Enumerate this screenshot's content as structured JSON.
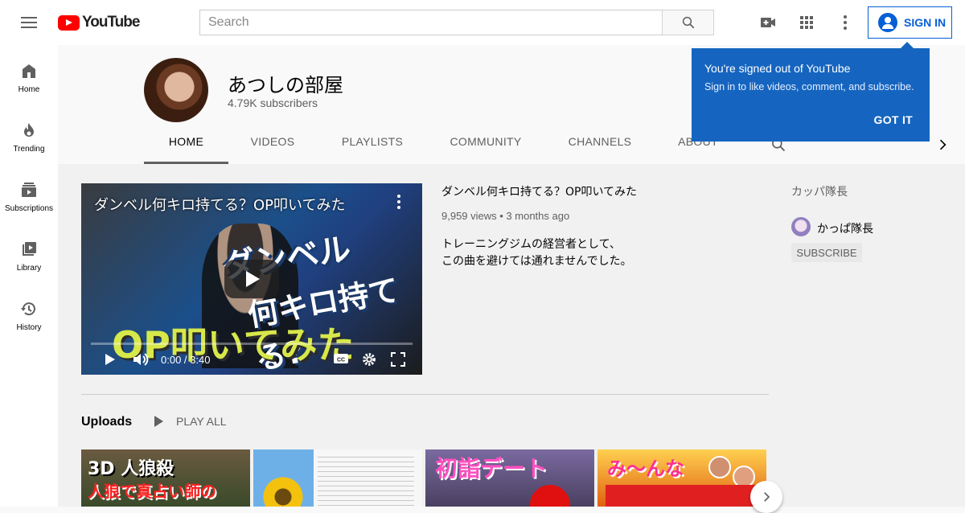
{
  "header": {
    "logo_text": "YouTube",
    "search_placeholder": "Search",
    "signin_label": "SIGN IN",
    "icons": [
      "menu-icon",
      "video-camera-icon",
      "apps-grid-icon",
      "more-vert-icon",
      "search-icon",
      "account-circle-icon"
    ]
  },
  "sidebar": {
    "items": [
      {
        "label": "Home",
        "icon": "home-icon"
      },
      {
        "label": "Trending",
        "icon": "flame-icon"
      },
      {
        "label": "Subscriptions",
        "icon": "subscriptions-icon"
      },
      {
        "label": "Library",
        "icon": "library-icon"
      },
      {
        "label": "History",
        "icon": "history-icon"
      }
    ]
  },
  "channel": {
    "name": "あつしの部屋",
    "subscribers": "4.79K subscribers",
    "tabs": [
      {
        "label": "HOME",
        "active": true
      },
      {
        "label": "VIDEOS"
      },
      {
        "label": "PLAYLISTS"
      },
      {
        "label": "COMMUNITY"
      },
      {
        "label": "CHANNELS"
      },
      {
        "label": "ABOUT"
      }
    ]
  },
  "featured_video": {
    "overlay_title": "ダンベル何キロ持てる？OP叩いてみた",
    "title": "ダンベル何キロ持てる？OP叩いてみた",
    "meta": "9,959 views • 3 months ago",
    "description": "トレーニングジムの経営者として、\nこの曲を避けては通れませんでした。",
    "time": "0:00 / 3:40",
    "thumb_text": [
      "ダンベル",
      "何キロ持てる?",
      "OP叩いてみた"
    ]
  },
  "uploads": {
    "title": "Uploads",
    "play_all": "PLAY ALL",
    "thumbs": [
      {
        "line1": "3D 人狼殺",
        "line2": "人狼で真占い師の"
      },
      {
        "line1": "",
        "line2": ""
      },
      {
        "line1": "初詣デート",
        "line2": ""
      },
      {
        "line1": "み〜んな",
        "line2": ""
      }
    ]
  },
  "featured_channel": {
    "section_title": "カッパ隊長",
    "name": "かっぱ隊長",
    "subscribe_label": "SUBSCRIBE"
  },
  "popup": {
    "title": "You're signed out of YouTube",
    "body": "Sign in to like videos, comment, and subscribe.",
    "button": "GOT IT"
  },
  "colors": {
    "brand_red": "#ff0000",
    "accent_blue": "#065fd4",
    "popup_blue": "#1565c0"
  }
}
